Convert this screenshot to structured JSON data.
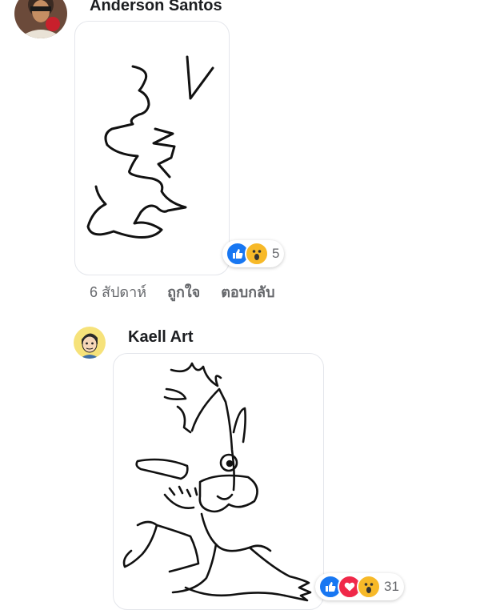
{
  "comments": [
    {
      "author": "Anderson Santos",
      "reactions": {
        "icons": [
          "like-icon",
          "wow-icon"
        ],
        "count": "5"
      },
      "actions": {
        "time": "6 สัปดาห์",
        "like": "ถูกใจ",
        "reply": "ตอบกลับ"
      }
    },
    {
      "author": "Kaell Art",
      "reactions": {
        "icons": [
          "like-icon",
          "love-icon",
          "wow-icon"
        ],
        "count": "31"
      }
    }
  ],
  "colors": {
    "like": "#1877f2",
    "love": "#f02849",
    "wow": "#f7b928",
    "meta_text": "#65676b"
  }
}
